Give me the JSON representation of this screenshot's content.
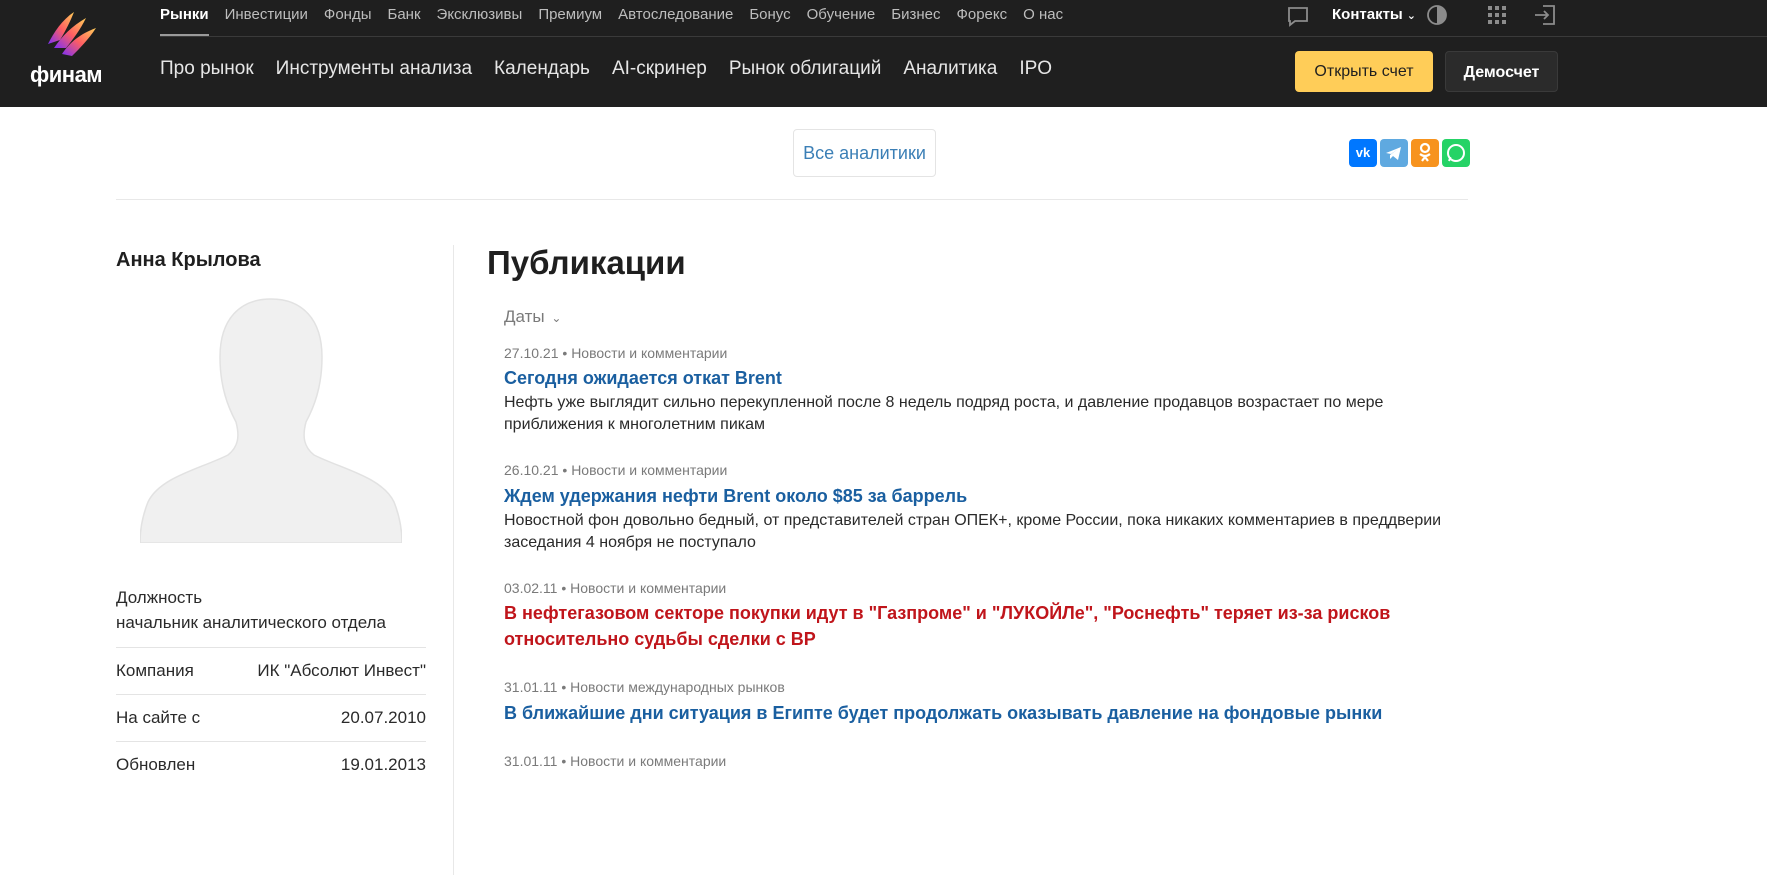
{
  "brand": {
    "name": "финам"
  },
  "topnav": [
    "Рынки",
    "Инвестиции",
    "Фонды",
    "Банк",
    "Эксклюзивы",
    "Премиум",
    "Автоследование",
    "Бонус",
    "Обучение",
    "Бизнес",
    "Форекс",
    "О нас"
  ],
  "mainnav": [
    "Про рынок",
    "Инструменты анализа",
    "Календарь",
    "AI-скринер",
    "Рынок облигаций",
    "Аналитика",
    "IPO"
  ],
  "header": {
    "contacts": "Контакты",
    "open_account": "Открыть счет",
    "demo_account": "Демосчет"
  },
  "subbar": {
    "all_analytics": "Все аналитики"
  },
  "share": [
    {
      "label": "VK",
      "color": "#0077ff"
    },
    {
      "label": "TG",
      "color": "#5fa9e0"
    },
    {
      "label": "OK",
      "color": "#f7931e"
    },
    {
      "label": "WA",
      "color": "#25d366"
    }
  ],
  "author": {
    "name": "Анна Крылова",
    "position_label": "Должность",
    "position_value": "начальник аналитического отдела",
    "rows": [
      {
        "k": "Компания",
        "v": "ИК \"Абсолют Инвест\""
      },
      {
        "k": "На сайте с",
        "v": "20.07.2010"
      },
      {
        "k": "Обновлен",
        "v": "19.01.2013"
      }
    ]
  },
  "publications": {
    "title": "Публикации",
    "filter": "Даты",
    "items": [
      {
        "date": "27.10.21",
        "category": "Новости и комментарии",
        "title": "Сегодня ожидается откат Brent",
        "desc": "Нефть уже выглядит сильно перекупленной после 8 недель подряд роста, и давление продавцов возрастает по мере приближения к многолетним пикам",
        "red": false
      },
      {
        "date": "26.10.21",
        "category": "Новости и комментарии",
        "title": "Ждем удержания нефти Brent около $85 за баррель",
        "desc": "Новостной фон довольно бедный, от представителей стран ОПЕК+, кроме России, пока никаких комментариев в преддверии заседания 4 ноября не поступало",
        "red": false
      },
      {
        "date": "03.02.11",
        "category": "Новости и комментарии",
        "title": "В нефтегазовом секторе покупки идут в \"Газпроме\" и \"ЛУКОЙЛе\", \"Роснефть\" теряет из-за рисков относительно судьбы сделки с ВР",
        "desc": "",
        "red": true
      },
      {
        "date": "31.01.11",
        "category": "Новости международных рынков",
        "title": "В ближайшие дни ситуация в Египте будет продолжать оказывать давление на фондовые рынки",
        "desc": "",
        "red": false
      },
      {
        "date": "31.01.11",
        "category": "Новости и комментарии",
        "title": "",
        "desc": "",
        "red": false
      }
    ]
  }
}
